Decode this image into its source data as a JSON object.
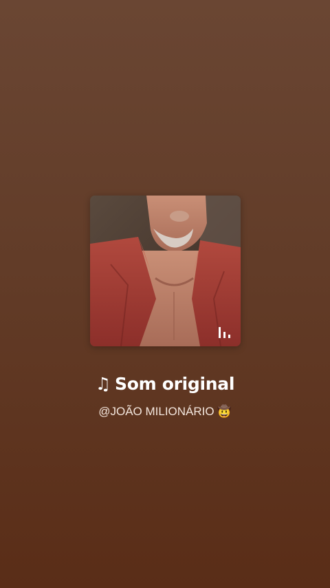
{
  "sound": {
    "title_icon": "♫",
    "title": "Som original",
    "author": "@JOÃO MILIONÁRIO",
    "author_emoji": "🤠",
    "cover_icon": "bar-chart-icon"
  },
  "colors": {
    "background_top": "#6a4633",
    "background_bottom": "#5a2d17",
    "title": "#ffffff",
    "author": "#f3e6dd"
  }
}
